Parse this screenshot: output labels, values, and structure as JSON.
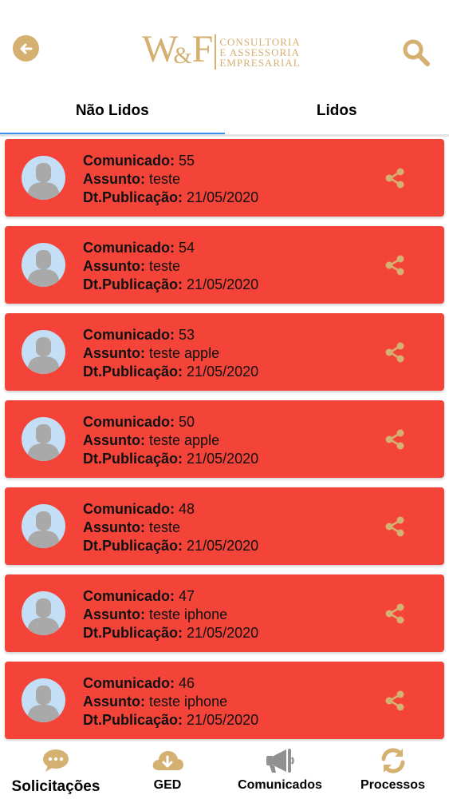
{
  "header": {
    "logo": {
      "mark": "W&F",
      "lines": [
        "CONSULTORIA",
        "E ASSESSORIA",
        "EMPRESARIAL"
      ]
    },
    "back_icon": "arrow-left-icon",
    "search_icon": "search-icon"
  },
  "tabs": [
    {
      "label": "Não Lidos",
      "active": true
    },
    {
      "label": "Lidos",
      "active": false
    }
  ],
  "labels": {
    "comunicado": "Comunicado:",
    "assunto": "Assunto:",
    "publicacao": "Dt.Publicação:"
  },
  "items": [
    {
      "comunicado": "55",
      "assunto": "teste",
      "publicacao": "21/05/2020"
    },
    {
      "comunicado": "54",
      "assunto": "teste",
      "publicacao": "21/05/2020"
    },
    {
      "comunicado": "53",
      "assunto": "teste apple",
      "publicacao": "21/05/2020"
    },
    {
      "comunicado": "50",
      "assunto": "teste apple",
      "publicacao": "21/05/2020"
    },
    {
      "comunicado": "48",
      "assunto": "teste",
      "publicacao": "21/05/2020"
    },
    {
      "comunicado": "47",
      "assunto": "teste iphone",
      "publicacao": "21/05/2020"
    },
    {
      "comunicado": "46",
      "assunto": "teste iphone",
      "publicacao": "21/05/2020"
    }
  ],
  "bottom_nav": [
    {
      "label": "Solicitações",
      "icon": "chat-icon"
    },
    {
      "label": "GED",
      "icon": "cloud-download-icon"
    },
    {
      "label": "Comunicados",
      "icon": "megaphone-icon"
    },
    {
      "label": "Processos",
      "icon": "sync-icon"
    }
  ],
  "colors": {
    "accent": "#d4b071",
    "card": "#f4443a",
    "tab_indicator": "#3b8ef0",
    "avatar_bg": "#c4dff5",
    "avatar_fg": "#a9a9a9",
    "nav_icon_inactive": "#909090"
  }
}
